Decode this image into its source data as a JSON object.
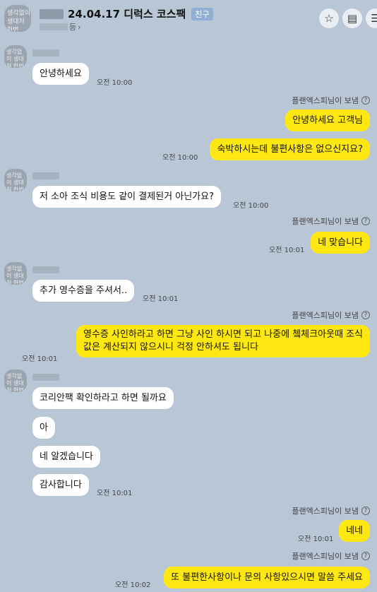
{
  "header": {
    "title": "24.04.17 디럭스 코스팩",
    "badge": "친구",
    "sub_suffix": "등",
    "avatar_text": "생각없이 생대처 한번"
  },
  "icons": {
    "star": "☆",
    "menu": "▤",
    "more": "☰",
    "chevron": "›",
    "help": "?"
  },
  "colors": {
    "background": "#b9c6d6",
    "outgoing": "#ffe812",
    "incoming": "#ffffff"
  },
  "sender_label": "플랜엑스피님이 보냄",
  "messages": [
    {
      "text": "안녕하세요",
      "time": "오전 10:00"
    },
    {
      "text": "안녕하세요 고객님"
    },
    {
      "text": "숙박하시는데 불편사항은 없으신지요?",
      "time": "오전 10:00"
    },
    {
      "text": "저 소아 조식 비용도 같이 결제된거 아닌가요?",
      "time": "오전 10:00"
    },
    {
      "text": "네 맞습니다",
      "time": "오전 10:01"
    },
    {
      "text": "추가 영수증을 주셔서..",
      "time": "오전 10:01"
    },
    {
      "line1": "영수증 사인하라고 하면 그냥 사인 하시면 되고 나중에 쳌체크아웃때 조식",
      "line2": "값은 계산되지 않으시니 걱정 안하셔도 됩니다",
      "time": "오전 10:01"
    },
    {
      "text": "코리안팩 확인하라고 하면 될까요"
    },
    {
      "text": "아"
    },
    {
      "text": "네 알겠습니다"
    },
    {
      "text": "감사합니다",
      "time": "오전 10:01"
    },
    {
      "text": "네네",
      "time": "오전 10:01"
    },
    {
      "text": "또 불편한사항이나 문의 사항있으시면 말씀 주세요",
      "time": "오전 10:02"
    }
  ]
}
